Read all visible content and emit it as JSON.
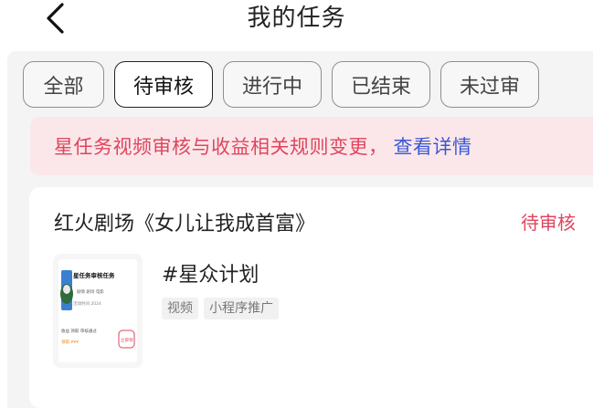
{
  "header": {
    "title": "我的任务",
    "back_icon": "chevron-left-icon"
  },
  "tabs": [
    {
      "label": "全部",
      "active": false
    },
    {
      "label": "待审核",
      "active": true
    },
    {
      "label": "进行中",
      "active": false
    },
    {
      "label": "已结束",
      "active": false
    },
    {
      "label": "未过审",
      "active": false
    }
  ],
  "notice": {
    "message": "星任务视频审核与收益相关规则变更，",
    "link": "查看详情"
  },
  "task": {
    "title": "红火剧场《女儿让我成首富》",
    "status": "待审核",
    "tag_title": "#星众计划",
    "chips": [
      "视频",
      "小程序推广"
    ],
    "thumbnail": {
      "heading": "星任务审核任务",
      "line1": "剧情 剧场 电影",
      "line2": "活动时间 2024",
      "line3": "收益 领取 审核通过",
      "line4": "领取 ¥¥¥",
      "button": "立即领"
    }
  },
  "colors": {
    "accent": "#e0455d",
    "link": "#3a57d6",
    "notice_bg": "#fbe7ea",
    "page_bg": "#f4f4f4"
  }
}
